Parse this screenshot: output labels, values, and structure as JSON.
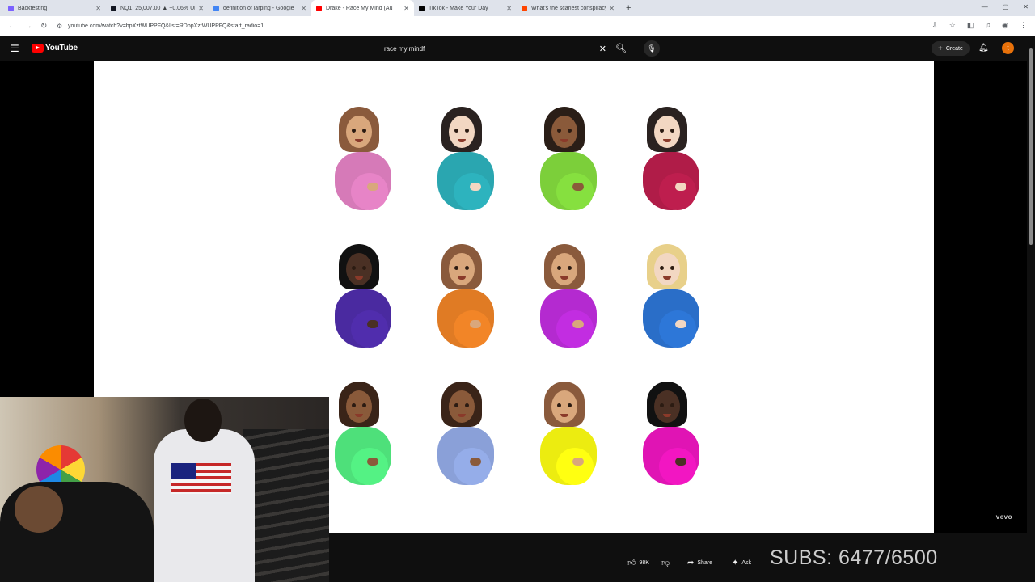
{
  "browser": {
    "tabs": [
      {
        "title": "Backtesting",
        "favicon_color": "#7b61ff",
        "active": false
      },
      {
        "title": "NQ1! 25,007.00 ▲ +0.06% Unn",
        "favicon_color": "#131722",
        "active": false
      },
      {
        "title": "definition of larping - Google",
        "favicon_color": "#4285f4",
        "active": false
      },
      {
        "title": "Drake - Race My Mind (Au",
        "favicon_color": "#ff0000",
        "active": true
      },
      {
        "title": "TikTok - Make Your Day",
        "favicon_color": "#000000",
        "active": false
      },
      {
        "title": "What's the scariest conspiracy",
        "favicon_color": "#ff4500",
        "active": false
      }
    ],
    "url": "youtube.com/watch?v=bpXztWUPPFQ&list=RDbpXztWUPPFQ&start_radio=1"
  },
  "youtube": {
    "logo_text": "YouTube",
    "search_value": "race my mindf",
    "create_label": "Create",
    "avatar_letter": "t"
  },
  "video": {
    "watermark": "vevo",
    "emojis": [
      {
        "hair": "#8a5a3c",
        "skin": "#d9a77c",
        "shirt": "#d67ab8"
      },
      {
        "hair": "#2a2220",
        "skin": "#f2d7c2",
        "shirt": "#2aa6b0"
      },
      {
        "hair": "#2a1e17",
        "skin": "#8a5a3a",
        "shirt": "#7ccf3a"
      },
      {
        "hair": "#2a2220",
        "skin": "#f2d7c2",
        "shirt": "#b01c48"
      },
      {
        "hair": "#111111",
        "skin": "#4a3024",
        "shirt": "#4a2aa0"
      },
      {
        "hair": "#8a5a3c",
        "skin": "#d9a77c",
        "shirt": "#e07b24"
      },
      {
        "hair": "#8a5a3c",
        "skin": "#d9a77c",
        "shirt": "#b42ad0"
      },
      {
        "hair": "#e8d08a",
        "skin": "#f2d7c2",
        "shirt": "#2a6ec8"
      },
      {
        "hair": "#3a2418",
        "skin": "#8a5a3a",
        "shirt": "#4ee07a"
      },
      {
        "hair": "#3a2418",
        "skin": "#8a5a3a",
        "shirt": "#8aa0d8"
      },
      {
        "hair": "#8a5a3c",
        "skin": "#d9a77c",
        "shirt": "#ecec10"
      },
      {
        "hair": "#111111",
        "skin": "#4a3024",
        "shirt": "#e014b4"
      }
    ]
  },
  "actions": {
    "like_count": "98K",
    "share_label": "Share",
    "ask_label": "Ask"
  },
  "overlay": {
    "subs_text": "SUBS: 6477/6500"
  }
}
